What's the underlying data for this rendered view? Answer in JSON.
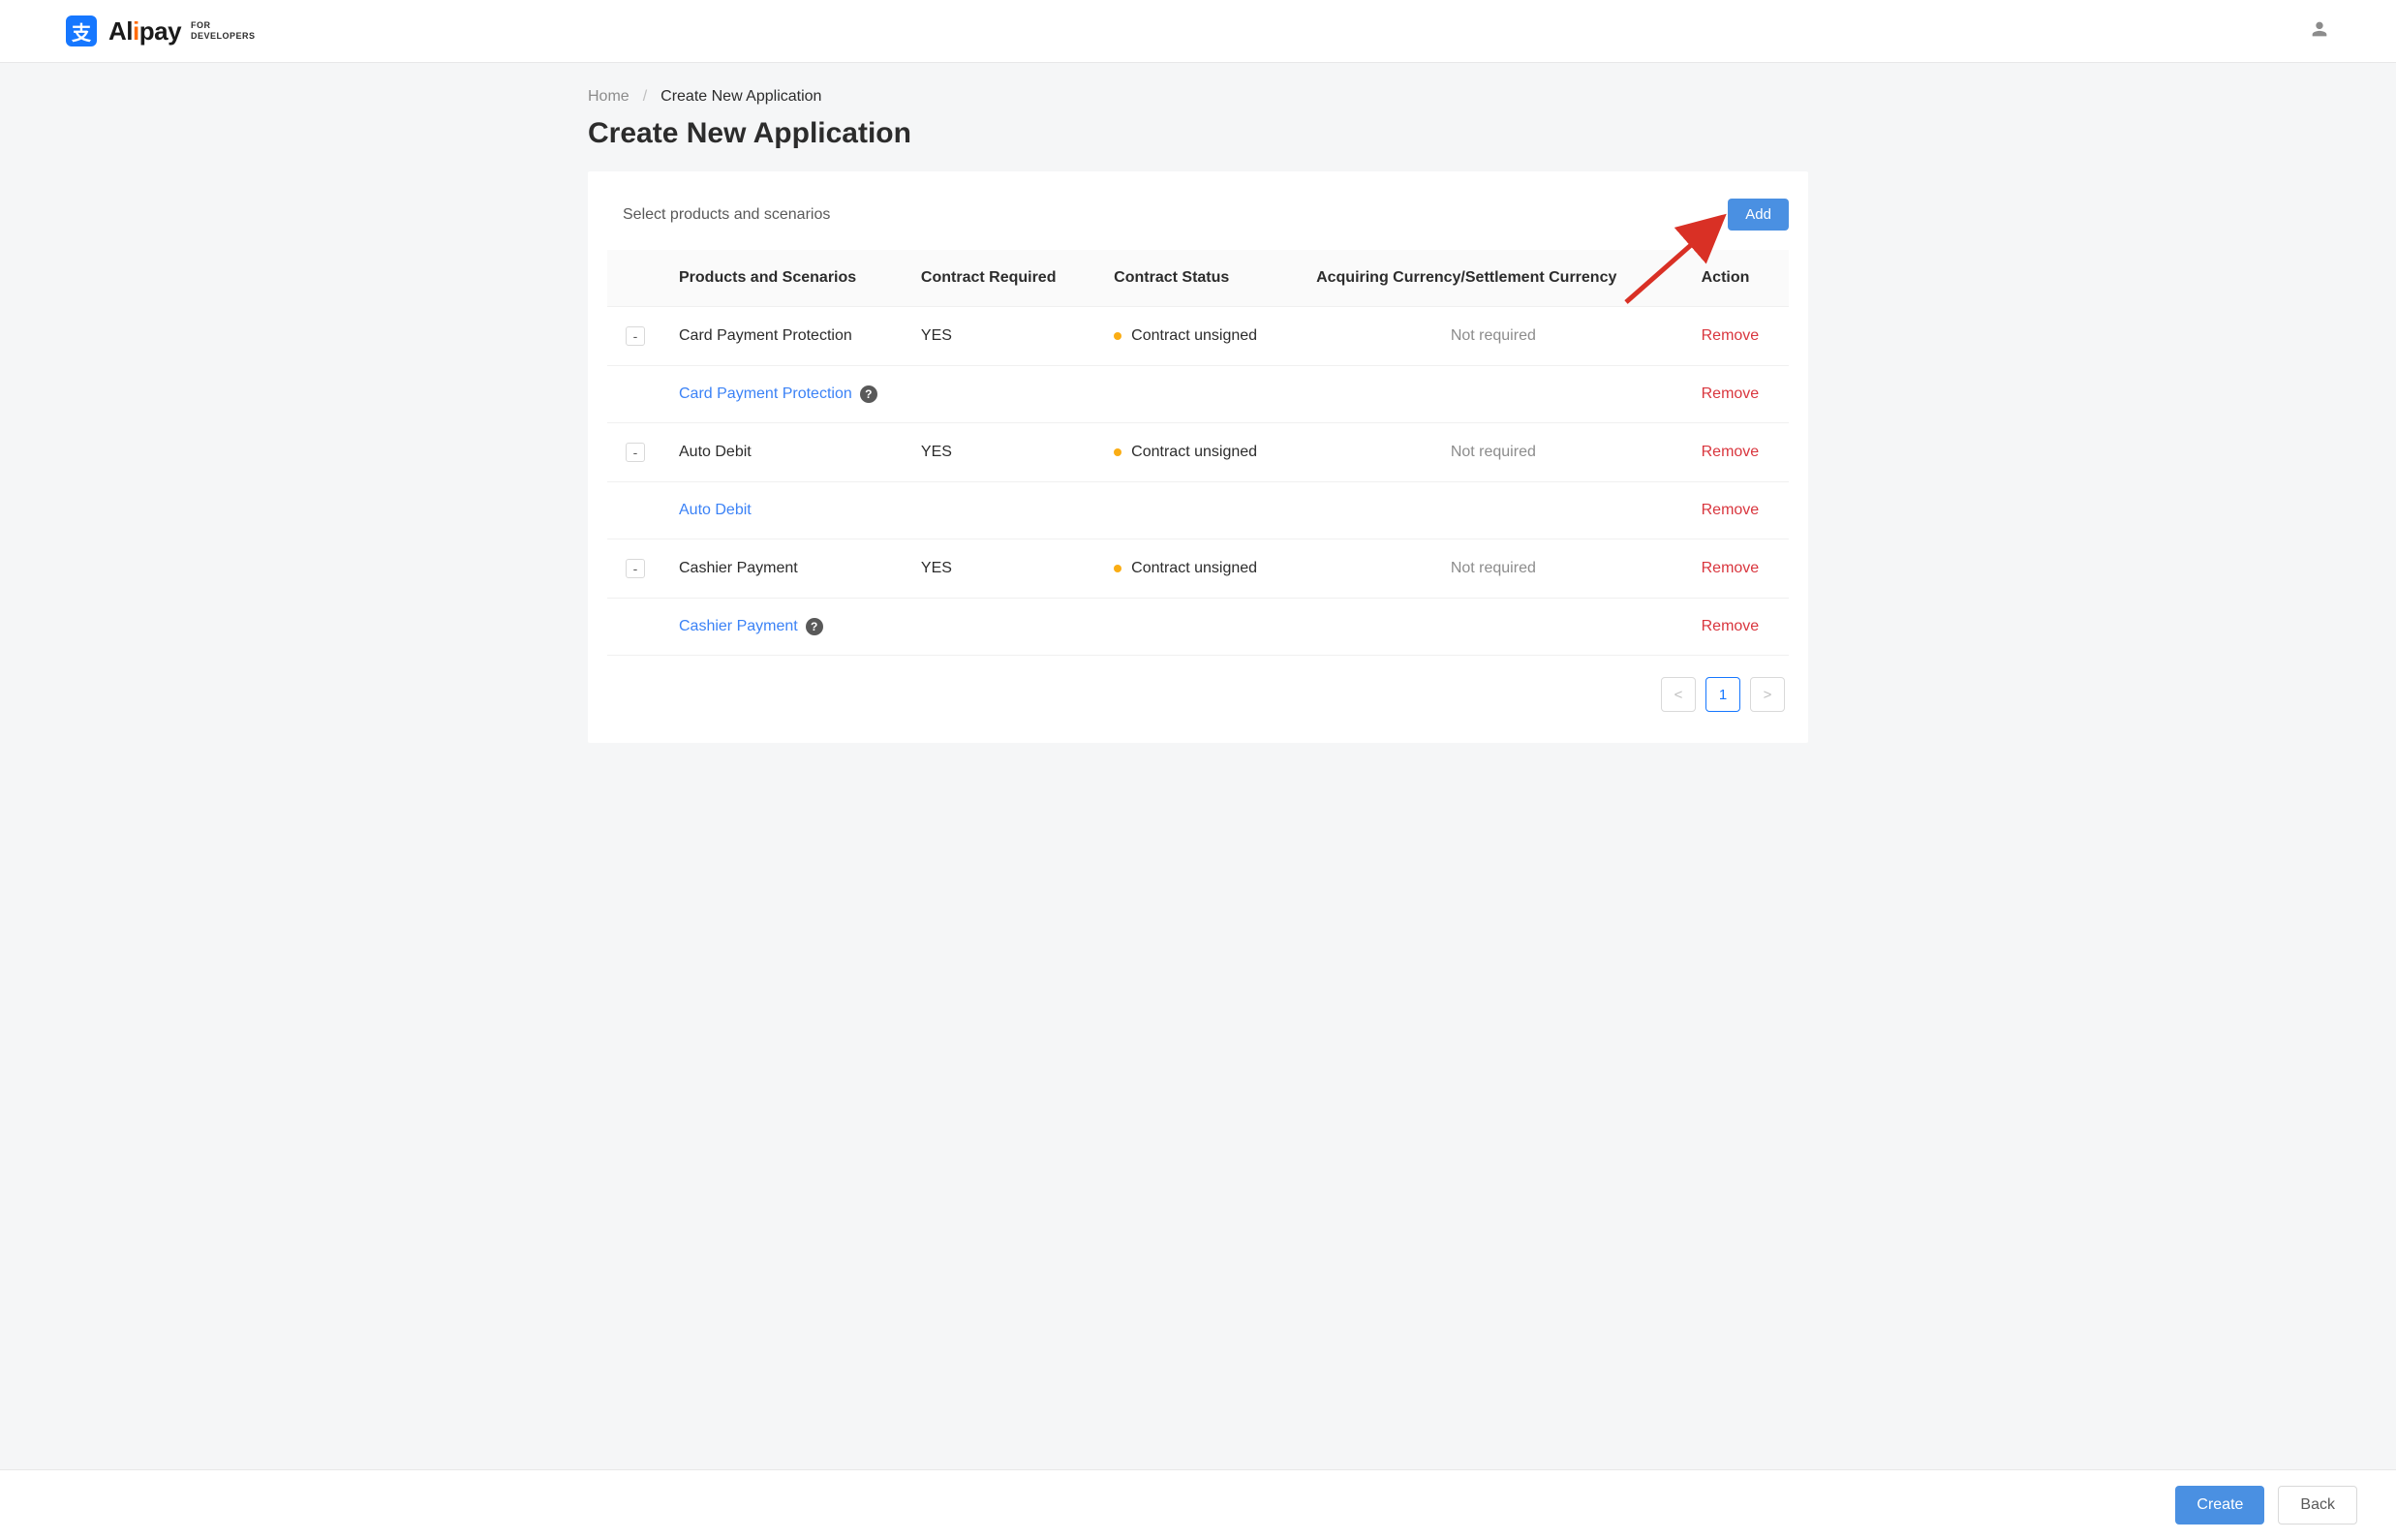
{
  "header": {
    "brand_main": "Al",
    "brand_accent": "i",
    "brand_suffix": "pay",
    "brand_sub_line1": "FOR",
    "brand_sub_line2": "DEVELOPERS",
    "logo_glyph": "支"
  },
  "breadcrumb": {
    "home": "Home",
    "sep": "/",
    "current": "Create New Application"
  },
  "page_title": "Create New Application",
  "section_label": "Select products and scenarios",
  "add_button": "Add",
  "table": {
    "headers": {
      "products": "Products and Scenarios",
      "contract_required": "Contract Required",
      "contract_status": "Contract Status",
      "currency": "Acquiring Currency/Settlement Currency",
      "action": "Action"
    },
    "rows": [
      {
        "name": "Card Payment Protection",
        "required": "YES",
        "status": "Contract unsigned",
        "currency": "Not required",
        "action": "Remove",
        "sub_name": "Card Payment Protection",
        "sub_action": "Remove",
        "sub_help": true
      },
      {
        "name": "Auto Debit",
        "required": "YES",
        "status": "Contract unsigned",
        "currency": "Not required",
        "action": "Remove",
        "sub_name": "Auto Debit",
        "sub_action": "Remove",
        "sub_help": false
      },
      {
        "name": "Cashier Payment",
        "required": "YES",
        "status": "Contract unsigned",
        "currency": "Not required",
        "action": "Remove",
        "sub_name": "Cashier Payment",
        "sub_action": "Remove",
        "sub_help": true
      }
    ]
  },
  "pagination": {
    "prev": "<",
    "current": "1",
    "next": ">"
  },
  "footer": {
    "create": "Create",
    "back": "Back"
  },
  "expand_glyph": "-",
  "help_glyph": "?"
}
